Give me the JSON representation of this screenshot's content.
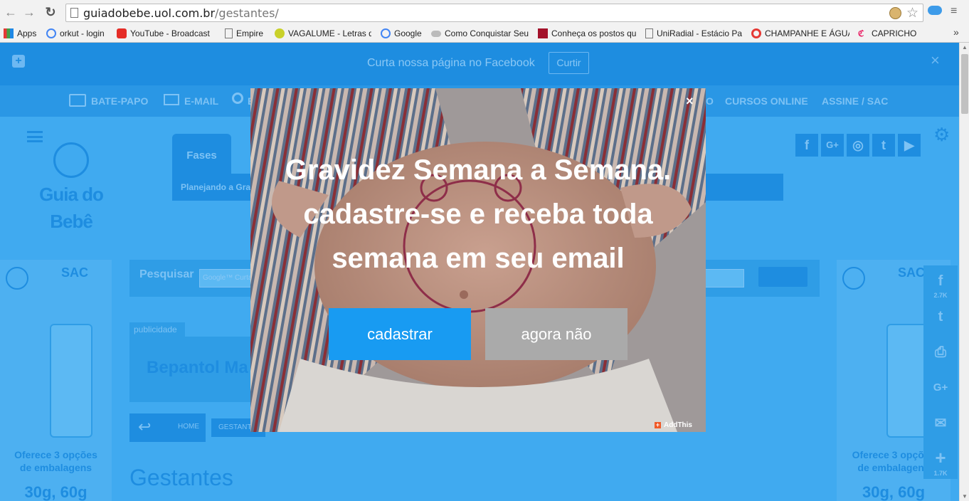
{
  "browser": {
    "url_host": "guiadobebe.uol.com.br",
    "url_path": "/gestantes/",
    "bookmarks": [
      {
        "label": "Apps"
      },
      {
        "label": "orkut - login"
      },
      {
        "label": "YouTube - Broadcast"
      },
      {
        "label": "Empire"
      },
      {
        "label": "VAGALUME - Letras d"
      },
      {
        "label": "Google"
      },
      {
        "label": "Como Conquistar Seu"
      },
      {
        "label": "Conheça os postos qu"
      },
      {
        "label": "UniRadial - Estácio Pa"
      },
      {
        "label": "CHAMPANHE E ÁGUA"
      },
      {
        "label": "CAPRICHO"
      }
    ],
    "more_label": "»"
  },
  "fb_bar": {
    "message": "Curta nossa página no Facebook",
    "button": "Curtir",
    "close": "×"
  },
  "topnav": {
    "items": [
      "BATE-PAPO",
      "E-MAIL",
      "B",
      "O",
      "CURSOS ONLINE",
      "ASSINE / SAC"
    ]
  },
  "site": {
    "logo_line1": "Guia do",
    "logo_line2": "Bebê",
    "tab_label": "Fases",
    "subnav_item": "Planejando a Gravidez",
    "social_icons": [
      "facebook-icon",
      "google-plus-icon",
      "instagram-icon",
      "twitter-icon",
      "youtube-icon"
    ]
  },
  "search": {
    "label": "Pesquisar",
    "placeholder": "Google™ Curta"
  },
  "ads": {
    "sac": "SAC",
    "line1": "Oferece 3 opções",
    "line2": "de embalagens",
    "line3": "30g, 60g",
    "publicidade": "publicidade",
    "banner_text": "Bepantol Ma"
  },
  "breadcrumb": {
    "home": "HOME",
    "current": "GESTANTES"
  },
  "page_heading": "Gestantes",
  "share": {
    "facebook_count": "2.7K",
    "more_count": "1.7K"
  },
  "modal": {
    "headline": [
      "Gravidez Semana a Semana.",
      "cadastre-se e receba toda",
      "semana em seu email"
    ],
    "primary_button": "cadastrar",
    "secondary_button": "agora não",
    "close": "×",
    "brand": "AddThis",
    "accent": "#189bf2"
  }
}
